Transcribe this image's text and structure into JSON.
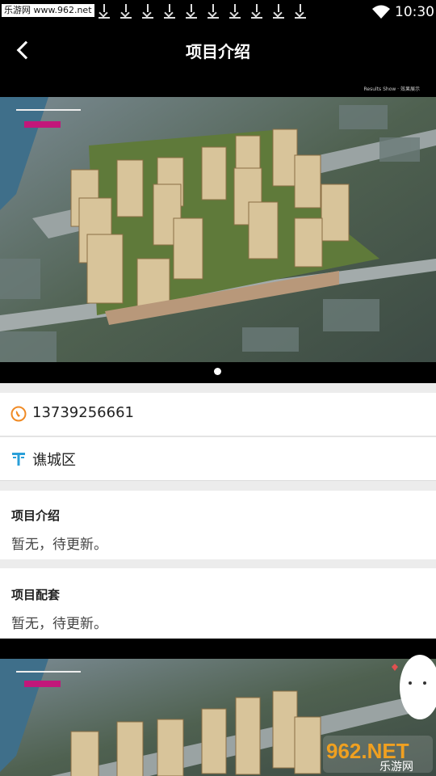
{
  "status_bar": {
    "watermark": "乐游网 www.962.net",
    "time": "10:30"
  },
  "header": {
    "title": "项目介绍",
    "results_caption": "Results Show · 效果展示"
  },
  "contact": {
    "phone": "13739256661",
    "district": "谯城区"
  },
  "sections": [
    {
      "title": "项目介绍",
      "body": "暂无，待更新。"
    },
    {
      "title": "项目配套",
      "body": "暂无，待更新。"
    }
  ],
  "carousel": {
    "current_index": 1,
    "total": 1
  },
  "site_logo": {
    "text": "962.NET",
    "subtext": "乐游网"
  },
  "colors": {
    "phone_icon": "#f08a24",
    "location_icon": "#2a9fd8",
    "accent_bg": "#000000"
  }
}
